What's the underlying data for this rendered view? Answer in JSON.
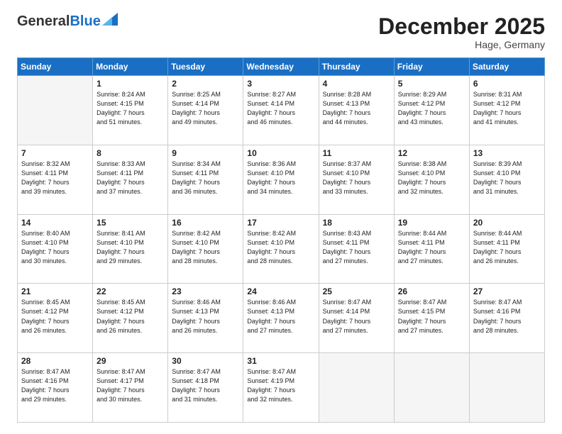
{
  "header": {
    "logo_general": "General",
    "logo_blue": "Blue",
    "month_title": "December 2025",
    "location": "Hage, Germany"
  },
  "weekdays": [
    "Sunday",
    "Monday",
    "Tuesday",
    "Wednesday",
    "Thursday",
    "Friday",
    "Saturday"
  ],
  "weeks": [
    [
      {
        "day": "",
        "info": ""
      },
      {
        "day": "1",
        "info": "Sunrise: 8:24 AM\nSunset: 4:15 PM\nDaylight: 7 hours\nand 51 minutes."
      },
      {
        "day": "2",
        "info": "Sunrise: 8:25 AM\nSunset: 4:14 PM\nDaylight: 7 hours\nand 49 minutes."
      },
      {
        "day": "3",
        "info": "Sunrise: 8:27 AM\nSunset: 4:14 PM\nDaylight: 7 hours\nand 46 minutes."
      },
      {
        "day": "4",
        "info": "Sunrise: 8:28 AM\nSunset: 4:13 PM\nDaylight: 7 hours\nand 44 minutes."
      },
      {
        "day": "5",
        "info": "Sunrise: 8:29 AM\nSunset: 4:12 PM\nDaylight: 7 hours\nand 43 minutes."
      },
      {
        "day": "6",
        "info": "Sunrise: 8:31 AM\nSunset: 4:12 PM\nDaylight: 7 hours\nand 41 minutes."
      }
    ],
    [
      {
        "day": "7",
        "info": "Sunrise: 8:32 AM\nSunset: 4:11 PM\nDaylight: 7 hours\nand 39 minutes."
      },
      {
        "day": "8",
        "info": "Sunrise: 8:33 AM\nSunset: 4:11 PM\nDaylight: 7 hours\nand 37 minutes."
      },
      {
        "day": "9",
        "info": "Sunrise: 8:34 AM\nSunset: 4:11 PM\nDaylight: 7 hours\nand 36 minutes."
      },
      {
        "day": "10",
        "info": "Sunrise: 8:36 AM\nSunset: 4:10 PM\nDaylight: 7 hours\nand 34 minutes."
      },
      {
        "day": "11",
        "info": "Sunrise: 8:37 AM\nSunset: 4:10 PM\nDaylight: 7 hours\nand 33 minutes."
      },
      {
        "day": "12",
        "info": "Sunrise: 8:38 AM\nSunset: 4:10 PM\nDaylight: 7 hours\nand 32 minutes."
      },
      {
        "day": "13",
        "info": "Sunrise: 8:39 AM\nSunset: 4:10 PM\nDaylight: 7 hours\nand 31 minutes."
      }
    ],
    [
      {
        "day": "14",
        "info": "Sunrise: 8:40 AM\nSunset: 4:10 PM\nDaylight: 7 hours\nand 30 minutes."
      },
      {
        "day": "15",
        "info": "Sunrise: 8:41 AM\nSunset: 4:10 PM\nDaylight: 7 hours\nand 29 minutes."
      },
      {
        "day": "16",
        "info": "Sunrise: 8:42 AM\nSunset: 4:10 PM\nDaylight: 7 hours\nand 28 minutes."
      },
      {
        "day": "17",
        "info": "Sunrise: 8:42 AM\nSunset: 4:10 PM\nDaylight: 7 hours\nand 28 minutes."
      },
      {
        "day": "18",
        "info": "Sunrise: 8:43 AM\nSunset: 4:11 PM\nDaylight: 7 hours\nand 27 minutes."
      },
      {
        "day": "19",
        "info": "Sunrise: 8:44 AM\nSunset: 4:11 PM\nDaylight: 7 hours\nand 27 minutes."
      },
      {
        "day": "20",
        "info": "Sunrise: 8:44 AM\nSunset: 4:11 PM\nDaylight: 7 hours\nand 26 minutes."
      }
    ],
    [
      {
        "day": "21",
        "info": "Sunrise: 8:45 AM\nSunset: 4:12 PM\nDaylight: 7 hours\nand 26 minutes."
      },
      {
        "day": "22",
        "info": "Sunrise: 8:45 AM\nSunset: 4:12 PM\nDaylight: 7 hours\nand 26 minutes."
      },
      {
        "day": "23",
        "info": "Sunrise: 8:46 AM\nSunset: 4:13 PM\nDaylight: 7 hours\nand 26 minutes."
      },
      {
        "day": "24",
        "info": "Sunrise: 8:46 AM\nSunset: 4:13 PM\nDaylight: 7 hours\nand 27 minutes."
      },
      {
        "day": "25",
        "info": "Sunrise: 8:47 AM\nSunset: 4:14 PM\nDaylight: 7 hours\nand 27 minutes."
      },
      {
        "day": "26",
        "info": "Sunrise: 8:47 AM\nSunset: 4:15 PM\nDaylight: 7 hours\nand 27 minutes."
      },
      {
        "day": "27",
        "info": "Sunrise: 8:47 AM\nSunset: 4:16 PM\nDaylight: 7 hours\nand 28 minutes."
      }
    ],
    [
      {
        "day": "28",
        "info": "Sunrise: 8:47 AM\nSunset: 4:16 PM\nDaylight: 7 hours\nand 29 minutes."
      },
      {
        "day": "29",
        "info": "Sunrise: 8:47 AM\nSunset: 4:17 PM\nDaylight: 7 hours\nand 30 minutes."
      },
      {
        "day": "30",
        "info": "Sunrise: 8:47 AM\nSunset: 4:18 PM\nDaylight: 7 hours\nand 31 minutes."
      },
      {
        "day": "31",
        "info": "Sunrise: 8:47 AM\nSunset: 4:19 PM\nDaylight: 7 hours\nand 32 minutes."
      },
      {
        "day": "",
        "info": ""
      },
      {
        "day": "",
        "info": ""
      },
      {
        "day": "",
        "info": ""
      }
    ]
  ]
}
